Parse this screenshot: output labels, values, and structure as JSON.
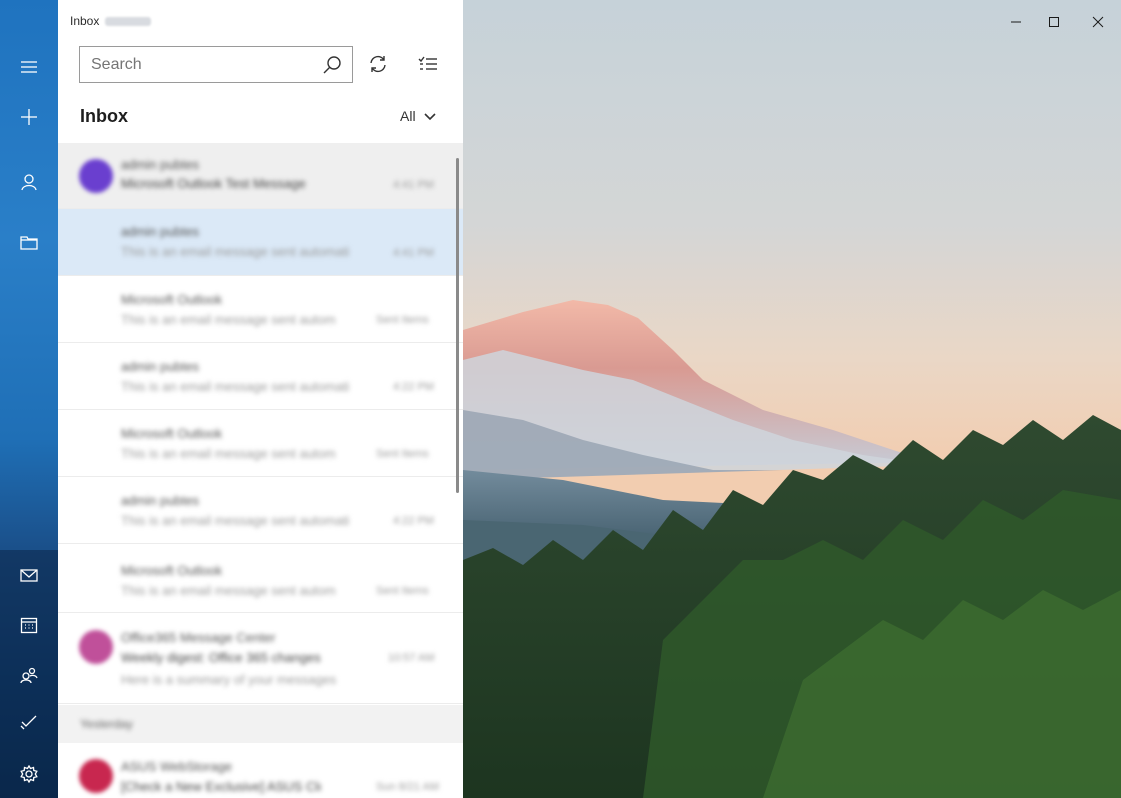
{
  "titlebar": {
    "folder_label": "Inbox"
  },
  "search": {
    "placeholder": "Search"
  },
  "list": {
    "title": "Inbox",
    "filter_label": "All",
    "messages": [
      {
        "sender": "admin pubtes",
        "subject": "Microsoft Outlook Test Message",
        "time": "4:41 PM"
      },
      {
        "sender": "admin pubtes",
        "preview": "This is an email message sent automati",
        "time": "4:41 PM"
      },
      {
        "sender": "Microsoft Outlook",
        "preview": "This is an email message sent autom",
        "time": "Sent Items"
      },
      {
        "sender": "admin pubtes",
        "preview": "This is an email message sent automati",
        "time": "4:22 PM"
      },
      {
        "sender": "Microsoft Outlook",
        "preview": "This is an email message sent autom",
        "time": "Sent Items"
      },
      {
        "sender": "admin pubtes",
        "preview": "This is an email message sent automati",
        "time": "4:22 PM"
      },
      {
        "sender": "Microsoft Outlook",
        "preview": "This is an email message sent autom",
        "time": "Sent Items"
      },
      {
        "sender": "Office365 Message Center",
        "subject": "Weekly digest: Office 365 changes",
        "preview": "Here is a summary of your messages",
        "time": "10:57 AM"
      },
      {
        "sender": "ASUS WebStorage",
        "subject": "[Check a New Exclusive] ASUS Clou",
        "time": "Sun 8/21 AM"
      }
    ],
    "group_yesterday": "Yesterday"
  },
  "colors": {
    "rail": "#1f73bf",
    "selected": "#dbe9f7",
    "hover": "#efefef"
  }
}
